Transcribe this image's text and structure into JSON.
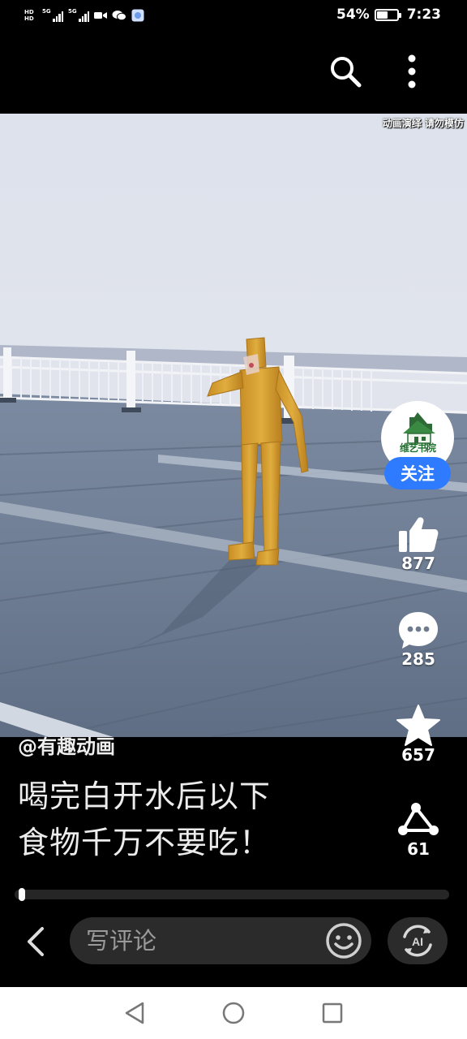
{
  "status_bar": {
    "hd_top": "HD",
    "hd_bottom": "HD",
    "sim1": "5G",
    "sim2": "5G",
    "battery_text": "54%",
    "battery_level": 0.54,
    "time": "7:23",
    "icons": [
      "hd-icon",
      "signal-icon",
      "signal-icon",
      "video-camera-icon",
      "wechat-icon",
      "image-icon"
    ]
  },
  "top_bar": {
    "icons": [
      "search-icon",
      "more-vertical-icon"
    ]
  },
  "video": {
    "watermark": "动画演绎 请勿模仿",
    "scene": "rooftop-with-yellow-figure"
  },
  "creator": {
    "avatar_text": "维艺书院",
    "follow_label": "关注",
    "handle": "@有趣动画"
  },
  "actions": {
    "likes": "877",
    "comments": "285",
    "favorites": "657",
    "shares": "61"
  },
  "caption": {
    "line1": "喝完白开水后以下",
    "line2": "食物千万不要吃！"
  },
  "playback": {
    "progress": 0.01
  },
  "bottom_bar": {
    "comment_placeholder": "写评论",
    "ai_label": "AI"
  },
  "colors": {
    "accent": "#2f7bff",
    "background": "#000000",
    "figure": "#d6a232",
    "navbar": "#ffffff"
  }
}
